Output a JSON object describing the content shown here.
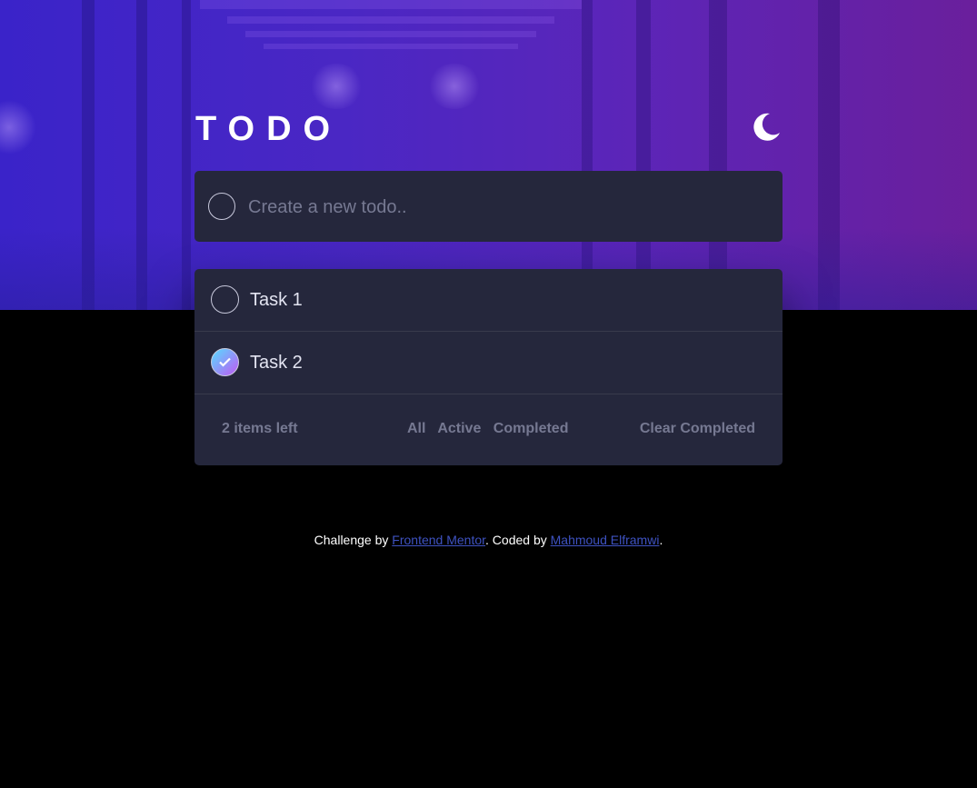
{
  "app": {
    "title": "TODO",
    "theme_icon": "moon-icon"
  },
  "new_todo": {
    "placeholder": "Create a new todo.."
  },
  "todos": [
    {
      "label": "Task 1",
      "completed": false
    },
    {
      "label": "Task 2",
      "completed": true
    }
  ],
  "footer": {
    "items_left": "2 items left",
    "filters": [
      "All",
      "Active",
      "Completed"
    ],
    "clear_label": "Clear Completed"
  },
  "attribution": {
    "prefix": "Challenge by ",
    "link1": "Frontend Mentor",
    "middle": ". Coded by ",
    "link2": "Mahmoud Elframwi",
    "suffix": "."
  },
  "colors": {
    "card": "#25273c",
    "muted_text": "#767992",
    "link": "#3e52c1",
    "check_gradient_start": "#57ddff",
    "check_gradient_end": "#c058f3"
  }
}
